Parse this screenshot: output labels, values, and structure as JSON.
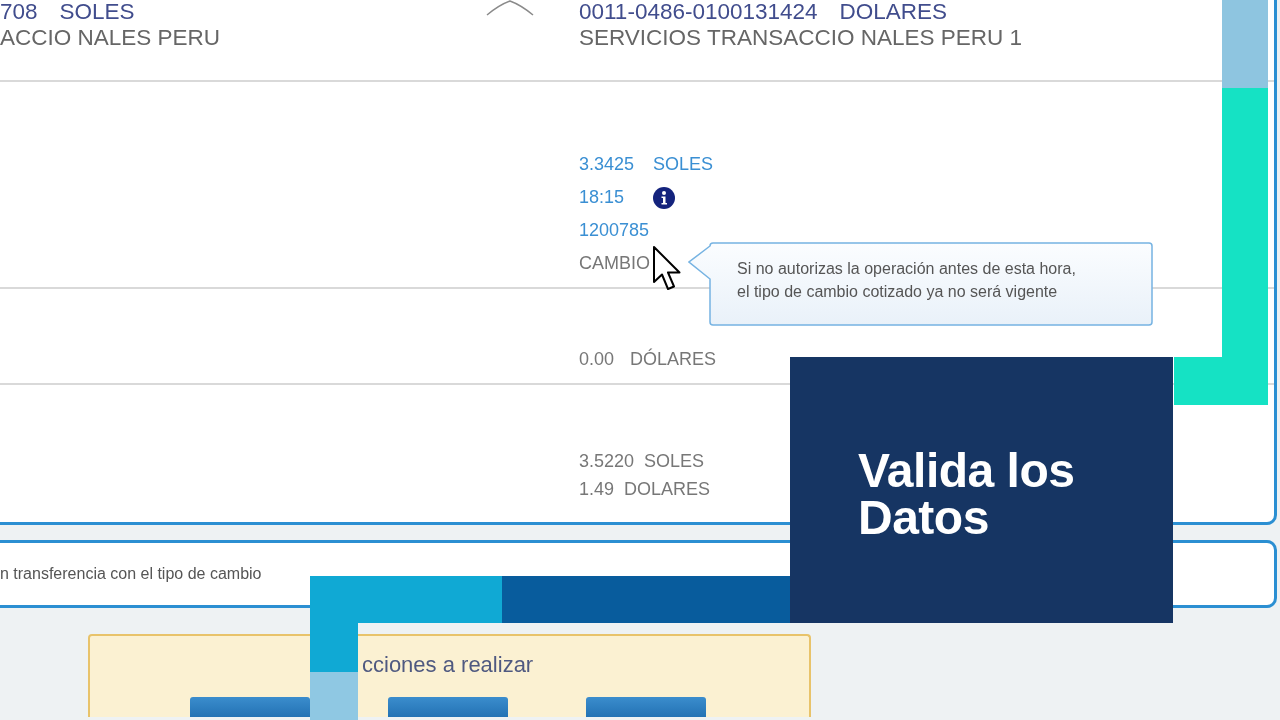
{
  "accounts": [
    {
      "number": "708",
      "currency": "SOLES",
      "holder": "ACCIO NALES PERU"
    },
    {
      "number": "0011-0486-0100131424",
      "currency": "DOLARES",
      "holder": "SERVICIOS TRANSACCIO NALES PERU 1"
    }
  ],
  "exchange": {
    "rate": "3.3425",
    "rate_currency": "SOLES",
    "expiry_time": "18:15",
    "operation_number": "1200785",
    "label": "CAMBIO",
    "tooltip": [
      "Si no autorizas la operación antes de esta hora,",
      "el tipo de cambio cotizado ya no será vigente"
    ]
  },
  "balance": {
    "amount": "0.00",
    "currency": "DÓLARES"
  },
  "totals": [
    {
      "amount": "3.5220",
      "currency": "SOLES"
    },
    {
      "amount": "1.49",
      "currency": "DOLARES"
    }
  ],
  "notice": "n transferencia con el tipo de cambio",
  "actions": {
    "title": "cciones a realizar"
  },
  "title_card": {
    "title": "Valida los Datos"
  }
}
